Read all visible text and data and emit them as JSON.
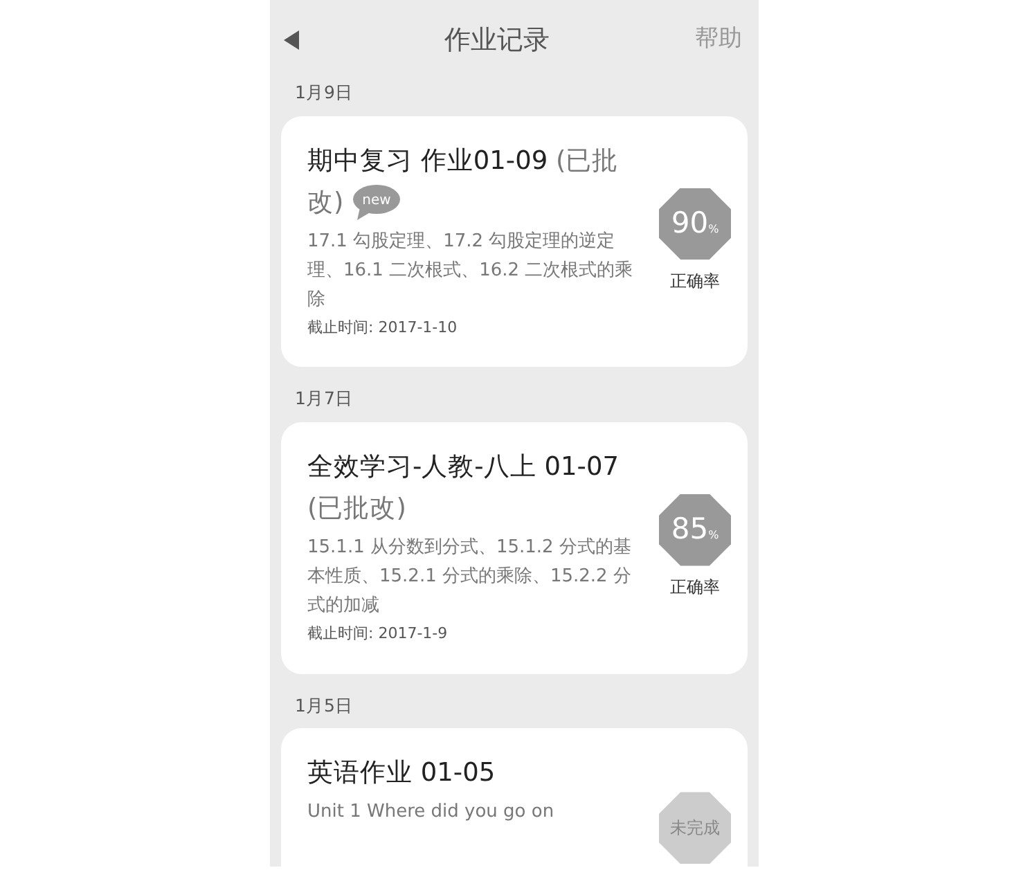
{
  "nav": {
    "title": "作业记录",
    "help": "帮助"
  },
  "groups": [
    {
      "date": "1月9日",
      "card": {
        "kind": "score",
        "title": "期中复习 作业01-09",
        "status": "(已批改)",
        "new_badge": "new",
        "description": "17.1 勾股定理、17.2 勾股定理的逆定理、16.1 二次根式、16.2 二次根式的乘除",
        "deadline": "截止时间: 2017-1-10",
        "score": "90",
        "unit": "%",
        "score_label": "正确率"
      }
    },
    {
      "date": "1月7日",
      "card": {
        "kind": "score",
        "title": "全效学习-人教-八上 01-07",
        "status": "(已批改)",
        "description": "15.1.1 从分数到分式、15.1.2 分式的基本性质、15.2.1 分式的乘除、15.2.2 分式的加减",
        "deadline": "截止时间: 2017-1-9",
        "score": "85",
        "unit": "%",
        "score_label": "正确率"
      }
    },
    {
      "date": "1月5日",
      "card": {
        "kind": "pending",
        "title": "英语作业 01-05",
        "description": "Unit 1 Where did you go on",
        "badge": "未完成"
      }
    }
  ]
}
